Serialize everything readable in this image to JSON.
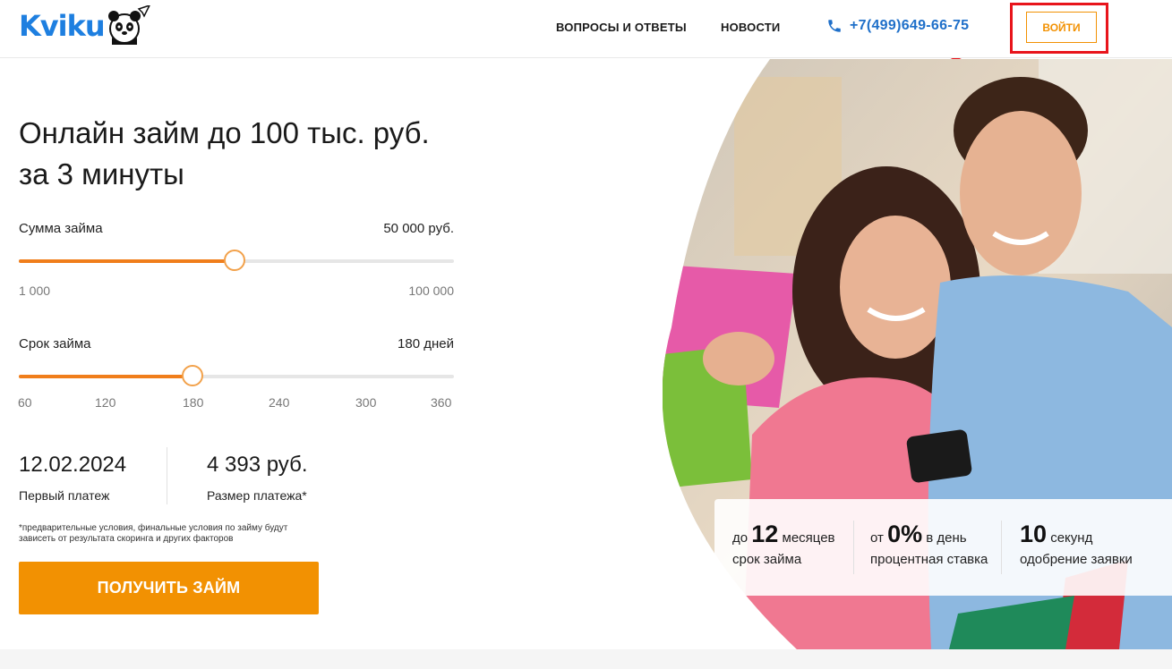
{
  "header": {
    "logo_text": "Kviku",
    "nav": {
      "faq": "ВОПРОСЫ И ОТВЕТЫ",
      "news": "НОВОСТИ"
    },
    "phone": "+7(499)649-66-75",
    "login_label": "ВОЙТИ"
  },
  "calculator": {
    "title_line1": "Онлайн займ до 100 тыс. руб.",
    "title_line2": "за 3 минуты",
    "amount": {
      "label": "Сумма займа",
      "value": "50 000 руб.",
      "min_label": "1 000",
      "max_label": "100 000",
      "level": 0.495
    },
    "term": {
      "label": "Срок займа",
      "value": "180 дней",
      "ticks": [
        "60",
        "120",
        "180",
        "240",
        "300",
        "360"
      ],
      "level": 0.4
    },
    "first_payment_date": "12.02.2024",
    "first_payment_label": "Первый платеж",
    "payment_amount": "4 393 руб.",
    "payment_amount_label": "Размер платежа*",
    "disclaimer": "*предварительные условия, финальные условия по займу будут зависеть от результата скоринга и других факторов",
    "cta_label": "ПОЛУЧИТЬ ЗАЙМ"
  },
  "stats": [
    {
      "prefix": "до",
      "big": "12",
      "suffix": "месяцев",
      "caption": "срок займа"
    },
    {
      "prefix": "от",
      "big": "0%",
      "suffix": "в день",
      "caption": "процентная ставка"
    },
    {
      "prefix": "",
      "big": "10",
      "suffix": "секунд",
      "caption": "одобрение заявки"
    }
  ],
  "colors": {
    "brand_blue": "#1e7fe0",
    "accent_orange": "#f29102",
    "slider_orange": "#f07e1b",
    "highlight_red": "#e8141b"
  }
}
